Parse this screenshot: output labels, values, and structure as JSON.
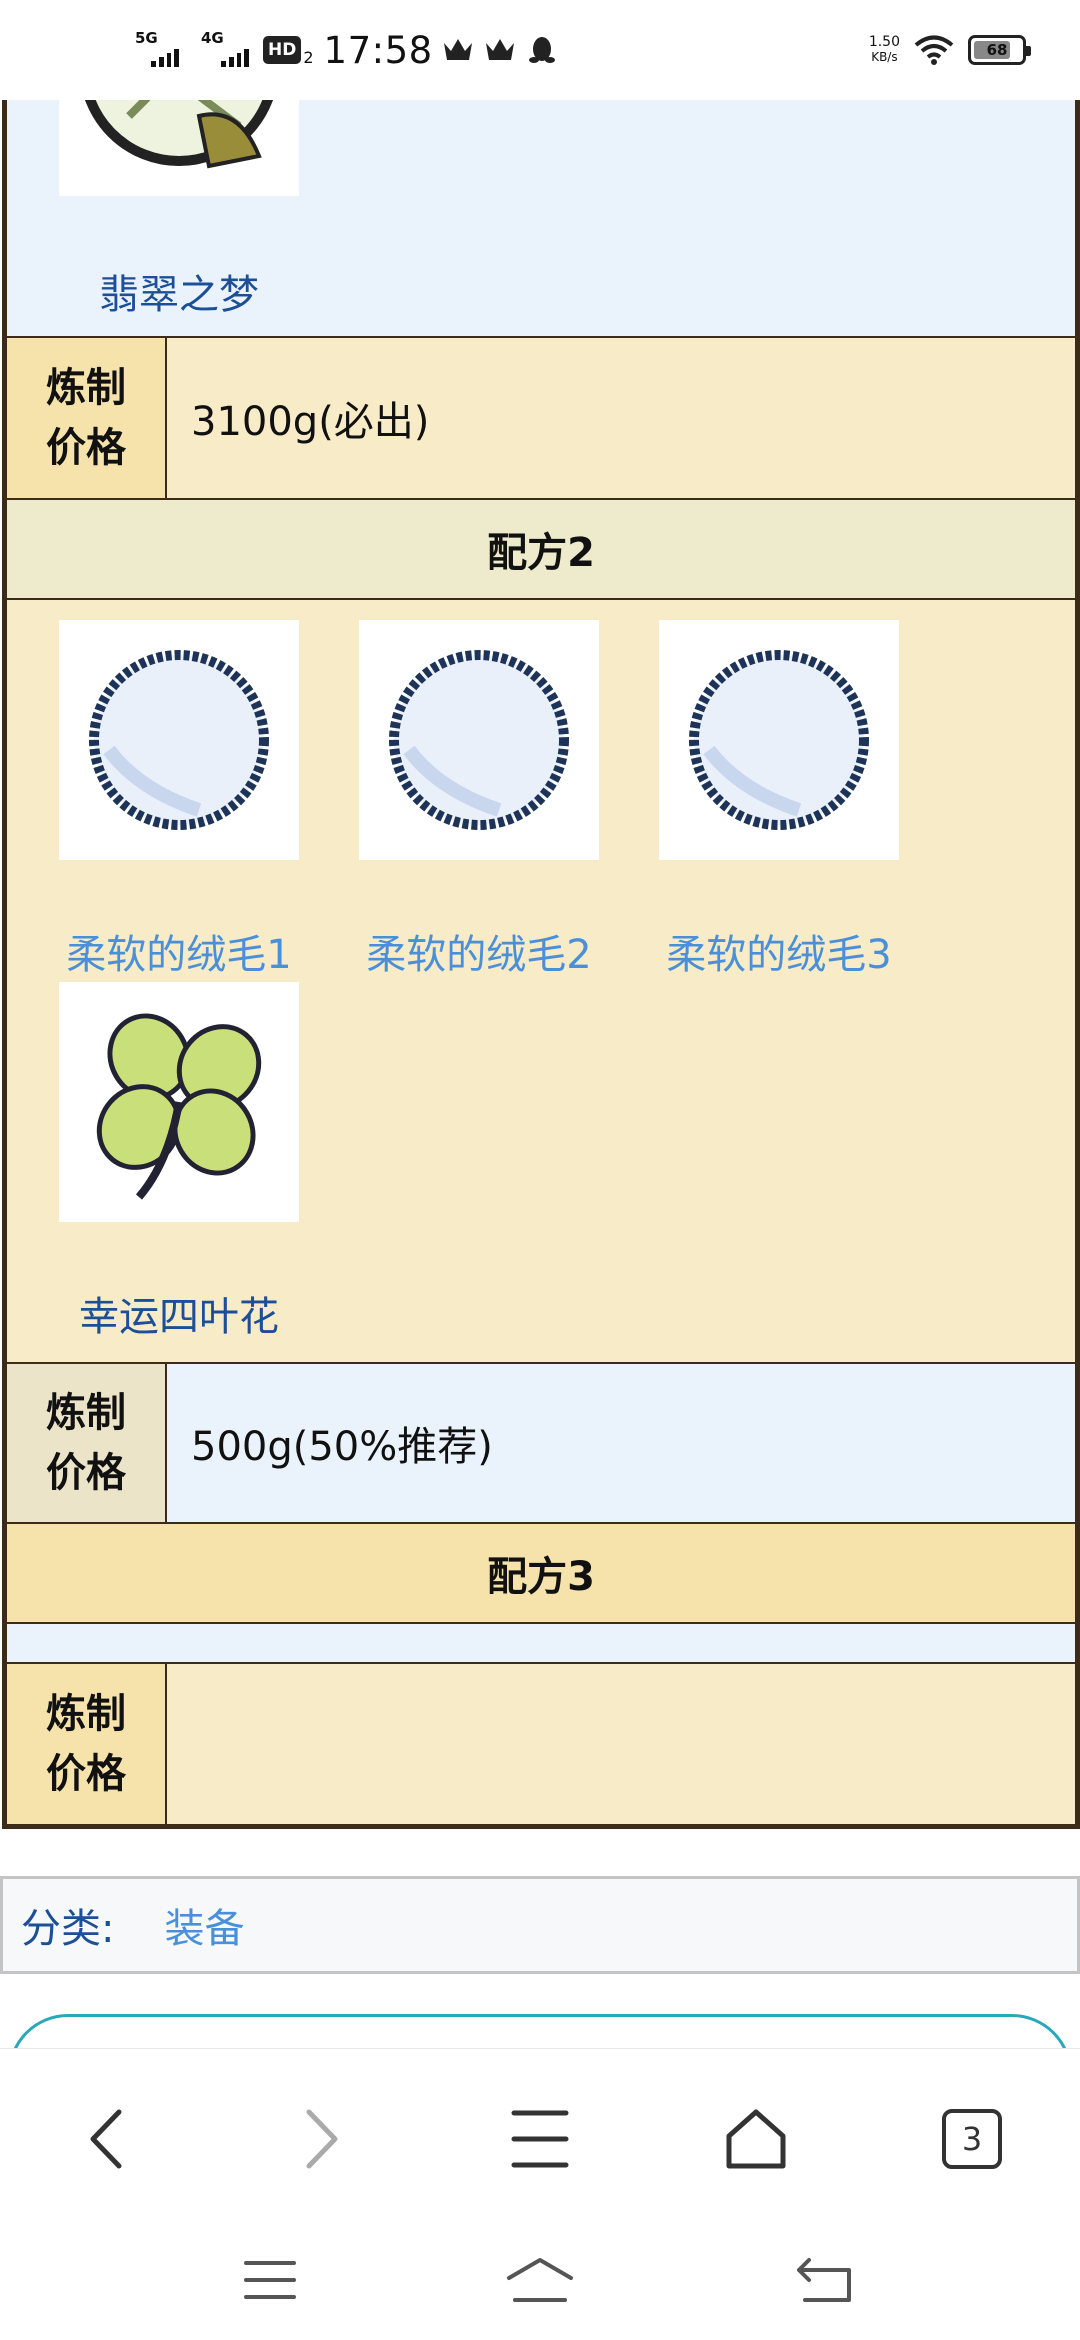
{
  "status_bar": {
    "network_1": "5G",
    "network_2": "4G",
    "hd_label": "HD",
    "hd_sub": "2",
    "time": "17:58",
    "speed_value": "1.50",
    "speed_unit": "KB/s",
    "battery_level": "68",
    "icons": [
      "crown-icon",
      "crown-icon",
      "qq-penguin-icon",
      "wifi-icon",
      "battery-icon"
    ]
  },
  "recipe_table": {
    "recipe1": {
      "items": [
        {
          "name": "翡翠之梦",
          "icon": "emerald-dream-icon"
        }
      ],
      "price_label": "炼制价格",
      "price_value": "3100g(必出)"
    },
    "recipe2": {
      "heading": "配方2",
      "items": [
        {
          "name": "柔软的绒毛1",
          "icon": "soft-fluff-icon"
        },
        {
          "name": "柔软的绒毛2",
          "icon": "soft-fluff-icon"
        },
        {
          "name": "柔软的绒毛3",
          "icon": "soft-fluff-icon"
        },
        {
          "name": "幸运四叶花",
          "icon": "four-leaf-clover-icon"
        }
      ],
      "price_label": "炼制价格",
      "price_value": "500g(50%推荐)"
    },
    "recipe3": {
      "heading": "配方3",
      "items": [],
      "price_label": "炼制价格",
      "price_value": ""
    }
  },
  "category": {
    "label": "分类:",
    "value": "装备"
  },
  "browser_toolbar": {
    "tab_count": "3",
    "buttons": [
      "back-icon",
      "forward-icon",
      "menu-icon",
      "home-icon",
      "tabs-icon"
    ]
  },
  "system_nav": {
    "buttons": [
      "recents-icon",
      "home-icon",
      "back-icon"
    ]
  },
  "colors": {
    "table_border": "#3d2b1a",
    "row_tan": "#f8ebc8",
    "row_blue": "#eaf3fc",
    "label_tan": "#f6e3ab",
    "link_dark": "#1c4f97",
    "link_light": "#4a90d9",
    "next_box_border": "#29a9b8"
  }
}
